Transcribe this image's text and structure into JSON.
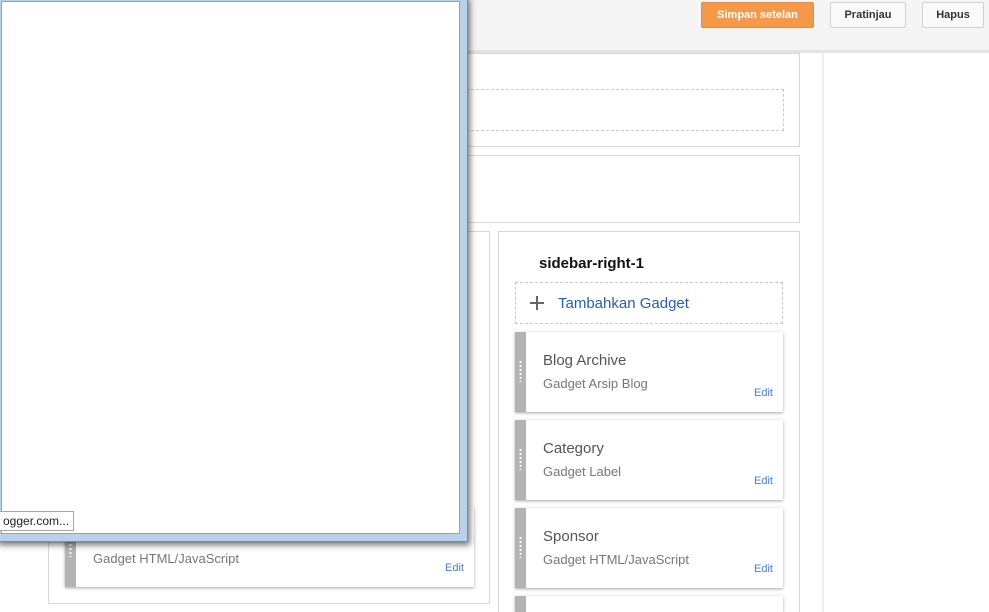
{
  "toolbar": {
    "save_label": "Simpan setelan",
    "preview_label": "Pratinjau",
    "delete_label": "Hapus"
  },
  "sidebar_right": {
    "title": "sidebar-right-1",
    "add_gadget_label": "Tambahkan Gadget",
    "gadgets": [
      {
        "title": "Blog Archive",
        "subtitle": "Gadget Arsip Blog",
        "edit": "Edit"
      },
      {
        "title": "Category",
        "subtitle": "Gadget Label",
        "edit": "Edit"
      },
      {
        "title": "Sponsor",
        "subtitle": "Gadget HTML/JavaScript",
        "edit": "Edit"
      }
    ]
  },
  "main_column": {
    "gadget": {
      "subtitle": "Gadget HTML/JavaScript",
      "edit": "Edit"
    }
  },
  "popup": {
    "status_url": "ogger.com..."
  },
  "colors": {
    "primary_button": "#f4994a",
    "link": "#2a5db0",
    "handle": "#b3b3b3"
  }
}
